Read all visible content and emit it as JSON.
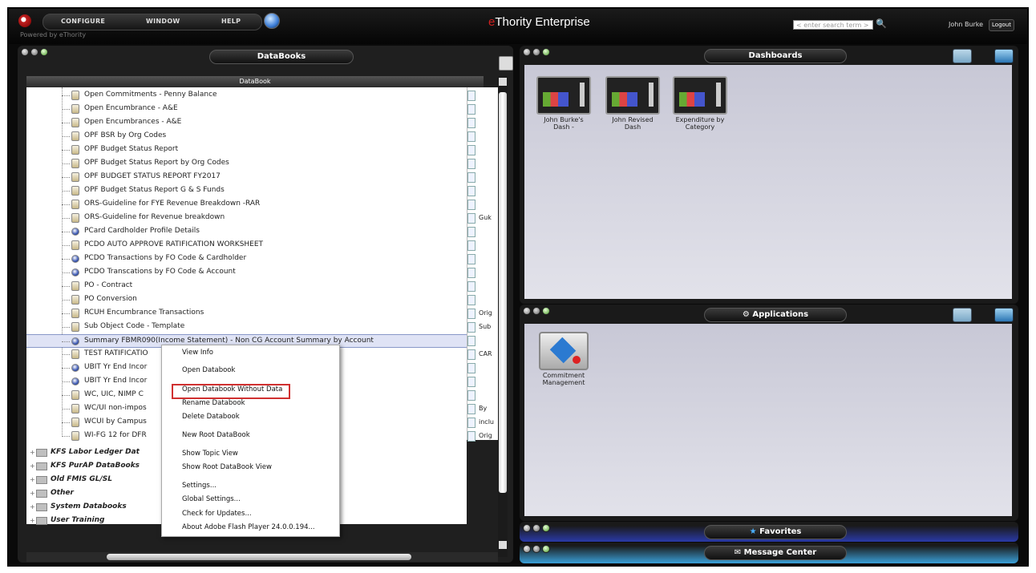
{
  "header": {
    "menu": [
      "CONFIGURE",
      "WINDOW",
      "HELP"
    ],
    "powered_by": "Powered by eThority",
    "app_title_e": "e",
    "app_title_rest": "Thority",
    "app_title_suffix": "Enterprise",
    "search_placeholder": "< enter search term >",
    "user_name": "John Burke",
    "logout_label": "Logout"
  },
  "databooks": {
    "panel_title": "DataBooks",
    "column_header": "DataBook",
    "rows": [
      {
        "label": "Open Commitments - Penny Balance",
        "icon": "file",
        "col": ""
      },
      {
        "label": "Open Encumbrance - A&E",
        "icon": "file",
        "col": ""
      },
      {
        "label": "Open Encumbrances - A&E",
        "icon": "file",
        "col": ""
      },
      {
        "label": "OPF BSR by Org Codes",
        "icon": "file",
        "col": ""
      },
      {
        "label": "OPF Budget Status Report",
        "icon": "file",
        "col": ""
      },
      {
        "label": "OPF Budget Status Report by Org Codes",
        "icon": "file",
        "col": ""
      },
      {
        "label": "OPF BUDGET STATUS REPORT FY2017",
        "icon": "file",
        "col": ""
      },
      {
        "label": "OPF Budget Status Report G & S Funds",
        "icon": "file",
        "col": ""
      },
      {
        "label": "ORS-Guideline for FYE Revenue Breakdown -RAR",
        "icon": "file",
        "col": ""
      },
      {
        "label": "ORS-Guideline for Revenue breakdown",
        "icon": "file",
        "col": "Guk"
      },
      {
        "label": "PCard Cardholder Profile Details",
        "icon": "db",
        "col": ""
      },
      {
        "label": "PCDO AUTO APPROVE RATIFICATION WORKSHEET",
        "icon": "file",
        "col": ""
      },
      {
        "label": "PCDO Transactions by FO Code & Cardholder",
        "icon": "db",
        "col": ""
      },
      {
        "label": "PCDO Transcations by FO Code & Account",
        "icon": "db",
        "col": ""
      },
      {
        "label": "PO - Contract",
        "icon": "file",
        "col": ""
      },
      {
        "label": "PO Conversion",
        "icon": "file",
        "col": ""
      },
      {
        "label": "RCUH Encumbrance Transactions",
        "icon": "file",
        "col": "Orig"
      },
      {
        "label": "Sub Object Code - Template",
        "icon": "file",
        "col": "Sub"
      },
      {
        "label": "Summary FBMR090(Income Statement) - Non CG Account Summary by Account",
        "icon": "db",
        "col": "",
        "selected": true
      },
      {
        "label": "TEST RATIFICATIO",
        "icon": "file",
        "col": "CAR"
      },
      {
        "label": "UBIT Yr End Incor",
        "icon": "db",
        "col": ""
      },
      {
        "label": "UBIT Yr End Incor",
        "icon": "db",
        "col": ""
      },
      {
        "label": "WC, UIC, NIMP C",
        "icon": "file",
        "col": ""
      },
      {
        "label": "WC/UI non-impos",
        "icon": "file",
        "col": "By"
      },
      {
        "label": "WCUI by Campus",
        "icon": "file",
        "col": "inclu"
      },
      {
        "label": "WI-FG 12 for DFR",
        "icon": "file",
        "col": "Orig"
      }
    ],
    "folders": [
      "KFS Labor Ledger Dat",
      "KFS PurAP DataBooks",
      "Old FMIS GL/SL",
      "Other",
      "System Databooks",
      "User Training"
    ]
  },
  "context_menu": {
    "items": [
      "View Info",
      "Open Databook",
      "Open Databook Without Data",
      "Rename Databook",
      "Delete Databook",
      "New Root DataBook",
      "Show Topic View",
      "Show Root DataBook View",
      "Settings...",
      "Global Settings...",
      "Check for Updates...",
      "About Adobe Flash Player 24.0.0.194..."
    ],
    "highlight_color": "#d03030"
  },
  "dashboards": {
    "panel_title": "Dashboards",
    "tiles": [
      "John Burke's Dash -",
      "John Revised Dash",
      "Expenditure by Category"
    ]
  },
  "applications": {
    "panel_title": "Applications",
    "tiles": [
      "Commitment Management"
    ]
  },
  "favorites": {
    "panel_title": "Favorites"
  },
  "message_center": {
    "panel_title": "Message Center"
  },
  "colors": {
    "favorites_bar": "#2a3aa8",
    "message_bar": "#3aa0d8",
    "brand_red": "#d02020"
  }
}
